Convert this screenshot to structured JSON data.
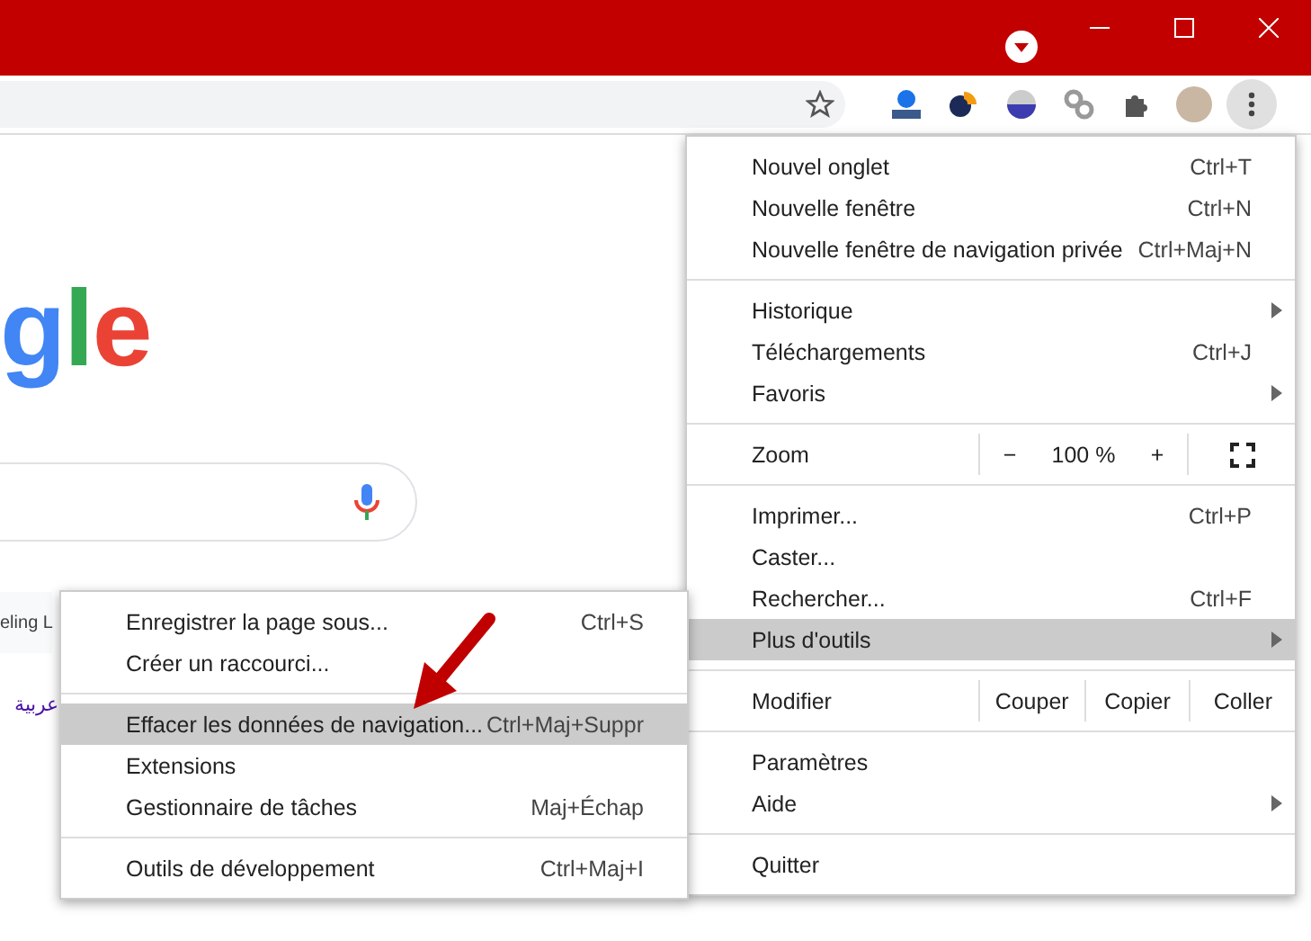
{
  "page": {
    "logo": [
      {
        "letter": "g",
        "color": "#4285f4"
      },
      {
        "letter": "l",
        "color": "#34a853"
      },
      {
        "letter": "e",
        "color": "#ea4335"
      }
    ],
    "lucky_button": "eling L",
    "language_link": "عربية"
  },
  "menu": {
    "items": [
      {
        "kind": "item",
        "label": "Nouvel onglet",
        "shortcut": "Ctrl+T",
        "has_submenu": false,
        "selected": false
      },
      {
        "kind": "item",
        "label": "Nouvelle fenêtre",
        "shortcut": "Ctrl+N",
        "has_submenu": false,
        "selected": false
      },
      {
        "kind": "item",
        "label": "Nouvelle fenêtre de navigation privée",
        "shortcut": "Ctrl+Maj+N",
        "has_submenu": false,
        "selected": false
      },
      {
        "kind": "separator"
      },
      {
        "kind": "item",
        "label": "Historique",
        "has_submenu": true,
        "selected": false
      },
      {
        "kind": "item",
        "label": "Téléchargements",
        "shortcut": "Ctrl+J",
        "has_submenu": false,
        "selected": false
      },
      {
        "kind": "item",
        "label": "Favoris",
        "has_submenu": true,
        "selected": false
      },
      {
        "kind": "separator"
      },
      {
        "kind": "zoom",
        "label": "Zoom",
        "minus": "−",
        "value": "100 %",
        "plus": "+"
      },
      {
        "kind": "separator"
      },
      {
        "kind": "item",
        "label": "Imprimer...",
        "shortcut": "Ctrl+P",
        "has_submenu": false,
        "selected": false
      },
      {
        "kind": "item",
        "label": "Caster...",
        "has_submenu": false,
        "selected": false
      },
      {
        "kind": "item",
        "label": "Rechercher...",
        "shortcut": "Ctrl+F",
        "has_submenu": false,
        "selected": false
      },
      {
        "kind": "item",
        "label": "Plus d'outils",
        "has_submenu": true,
        "selected": true
      },
      {
        "kind": "separator"
      },
      {
        "kind": "edit",
        "label": "Modifier",
        "buttons": [
          "Couper",
          "Copier",
          "Coller"
        ]
      },
      {
        "kind": "separator"
      },
      {
        "kind": "item",
        "label": "Paramètres",
        "has_submenu": false,
        "selected": false
      },
      {
        "kind": "item",
        "label": "Aide",
        "has_submenu": true,
        "selected": false
      },
      {
        "kind": "separator"
      },
      {
        "kind": "item",
        "label": "Quitter",
        "has_submenu": false,
        "selected": false
      }
    ]
  },
  "submenu": {
    "items": [
      {
        "kind": "item",
        "label": "Enregistrer la page sous...",
        "shortcut": "Ctrl+S",
        "selected": false
      },
      {
        "kind": "item",
        "label": "Créer un raccourci...",
        "selected": false
      },
      {
        "kind": "separator"
      },
      {
        "kind": "item",
        "label": "Effacer les données de navigation...",
        "shortcut": "Ctrl+Maj+Suppr",
        "selected": true
      },
      {
        "kind": "item",
        "label": "Extensions",
        "selected": false
      },
      {
        "kind": "item",
        "label": "Gestionnaire de tâches",
        "shortcut": "Maj+Échap",
        "selected": false
      },
      {
        "kind": "separator"
      },
      {
        "kind": "item",
        "label": "Outils de développement",
        "shortcut": "Ctrl+Maj+I",
        "selected": false
      }
    ]
  }
}
